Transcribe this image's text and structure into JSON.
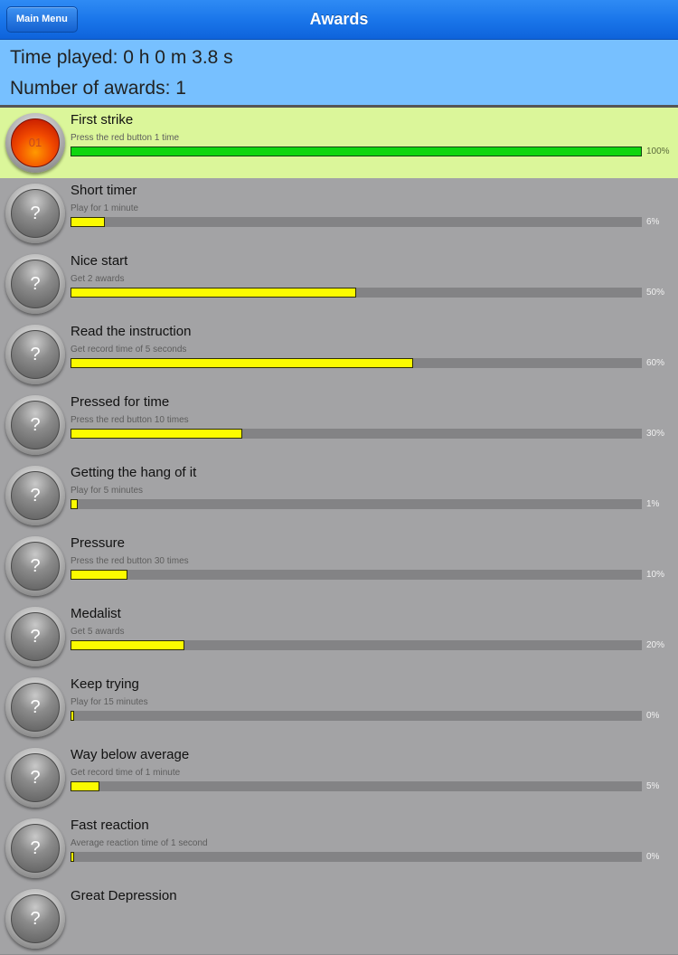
{
  "header": {
    "back_label": "Main Menu",
    "title": "Awards"
  },
  "summary": {
    "time_played": "Time played: 0 h 0 m 3.8 s",
    "awards_count": "Number of awards: 1"
  },
  "colors": {
    "nav_blue": "#1a76ea",
    "summary_blue": "#77c0ff",
    "unlocked_row": "#dbf69a",
    "locked_row": "#a3a3a5",
    "progress_yellow": "#fbfb00",
    "progress_green": "#0fd60f"
  },
  "awards": [
    {
      "badge": "01",
      "title": "First strike",
      "desc": "Press the red button 1 time",
      "progress": 100,
      "pct_label": "100%",
      "unlocked": true
    },
    {
      "badge": "?",
      "title": "Short timer",
      "desc": "Play for 1 minute",
      "progress": 6,
      "pct_label": "6%",
      "unlocked": false
    },
    {
      "badge": "?",
      "title": "Nice start",
      "desc": "Get 2 awards",
      "progress": 50,
      "pct_label": "50%",
      "unlocked": false
    },
    {
      "badge": "?",
      "title": "Read the instruction",
      "desc": "Get record time of 5 seconds",
      "progress": 60,
      "pct_label": "60%",
      "unlocked": false
    },
    {
      "badge": "?",
      "title": "Pressed for time",
      "desc": "Press the red button 10 times",
      "progress": 30,
      "pct_label": "30%",
      "unlocked": false
    },
    {
      "badge": "?",
      "title": "Getting the hang of it",
      "desc": "Play for 5 minutes",
      "progress": 1,
      "pct_label": "1%",
      "unlocked": false
    },
    {
      "badge": "?",
      "title": "Pressure",
      "desc": "Press the red button 30 times",
      "progress": 10,
      "pct_label": "10%",
      "unlocked": false
    },
    {
      "badge": "?",
      "title": "Medalist",
      "desc": "Get 5 awards",
      "progress": 20,
      "pct_label": "20%",
      "unlocked": false
    },
    {
      "badge": "?",
      "title": "Keep trying",
      "desc": "Play for 15 minutes",
      "progress": 0,
      "pct_label": "0%",
      "unlocked": false
    },
    {
      "badge": "?",
      "title": "Way below average",
      "desc": "Get record time of 1 minute",
      "progress": 5,
      "pct_label": "5%",
      "unlocked": false
    },
    {
      "badge": "?",
      "title": "Fast reaction",
      "desc": "Average reaction time of 1 second",
      "progress": 0,
      "pct_label": "0%",
      "unlocked": false
    },
    {
      "badge": "?",
      "title": "Great Depression",
      "desc": "",
      "progress": 0,
      "pct_label": "",
      "unlocked": false
    }
  ]
}
